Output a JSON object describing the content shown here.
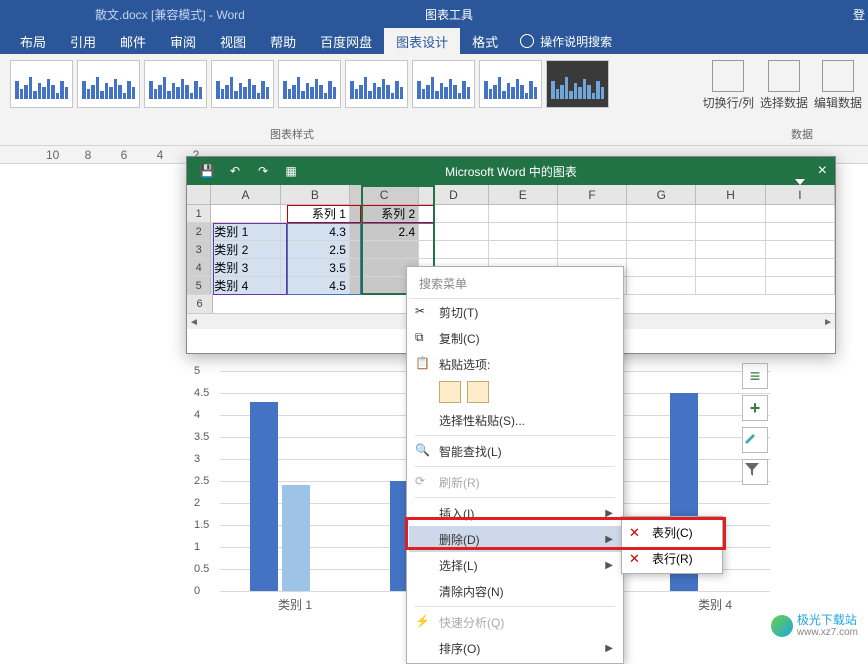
{
  "titlebar": {
    "doc_title": "散文.docx [兼容模式] - Word",
    "tools_label": "图表工具",
    "login": "登"
  },
  "ribbon": {
    "tabs": [
      "布局",
      "引用",
      "邮件",
      "审阅",
      "视图",
      "帮助",
      "百度网盘",
      "图表设计",
      "格式"
    ],
    "active_tab": "图表设计",
    "tell_me": "操作说明搜索",
    "section_styles": "图表样式",
    "section_data": "数据",
    "switch_rowcol": "切换行/列",
    "select_data": "选择数据",
    "edit_data": "编辑数据"
  },
  "ruler": [
    "10",
    "8",
    "6",
    "4",
    "2"
  ],
  "chart_win": {
    "title": "Microsoft Word 中的图表",
    "cols": [
      "A",
      "B",
      "C",
      "D",
      "E",
      "F",
      "G",
      "H",
      "I"
    ],
    "rows": [
      {
        "n": "1",
        "cells": [
          "",
          "系列 1",
          "系列 2",
          "",
          "",
          "",
          "",
          "",
          ""
        ]
      },
      {
        "n": "2",
        "cells": [
          "类别 1",
          "4.3",
          "2.4",
          "",
          "",
          "",
          "",
          "",
          ""
        ]
      },
      {
        "n": "3",
        "cells": [
          "类别 2",
          "2.5",
          "",
          "",
          "",
          "",
          "",
          "",
          ""
        ]
      },
      {
        "n": "4",
        "cells": [
          "类别 3",
          "3.5",
          "",
          "",
          "",
          "",
          "",
          "",
          ""
        ]
      },
      {
        "n": "5",
        "cells": [
          "类别 4",
          "4.5",
          "",
          "",
          "",
          "",
          "",
          "",
          ""
        ]
      }
    ]
  },
  "chart_data": {
    "type": "bar",
    "categories": [
      "类别 1",
      "类别 2",
      "类别 3",
      "类别 4"
    ],
    "series": [
      {
        "name": "系列 1",
        "values": [
          4.3,
          2.5,
          3.5,
          4.5
        ]
      },
      {
        "name": "系列 2",
        "values": [
          2.4,
          null,
          null,
          null
        ]
      }
    ],
    "ylabel": "",
    "xlabel": "",
    "ylim": [
      0,
      5
    ],
    "y_ticks": [
      0,
      0.5,
      1,
      1.5,
      2,
      2.5,
      3,
      3.5,
      4,
      4.5,
      5
    ]
  },
  "ctx": {
    "search": "搜索菜单",
    "cut": "剪切(T)",
    "copy": "复制(C)",
    "paste_opts": "粘贴选项:",
    "paste_special": "选择性粘贴(S)...",
    "smart_lookup": "智能查找(L)",
    "refresh": "刷新(R)",
    "insert": "插入(I)",
    "delete": "删除(D)",
    "select": "选择(L)",
    "clear": "清除内容(N)",
    "quick": "快速分析(Q)",
    "sort": "排序(O)"
  },
  "sub": {
    "col": "表列(C)",
    "row": "表行(R)"
  },
  "watermark": {
    "name": "极光下载站",
    "url": "www.xz7.com"
  }
}
